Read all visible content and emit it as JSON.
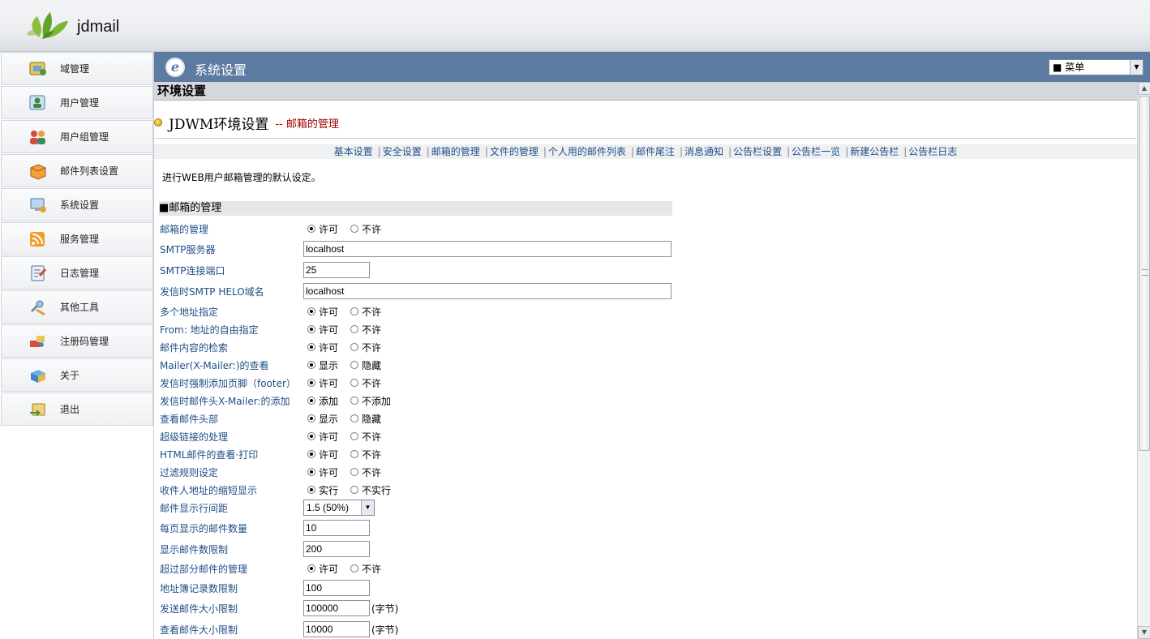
{
  "app": {
    "brand": "jdmail"
  },
  "sidebar": {
    "items": [
      {
        "label": "域管理",
        "icon": "domain-icon"
      },
      {
        "label": "用户管理",
        "icon": "user-icon"
      },
      {
        "label": "用户组管理",
        "icon": "group-icon"
      },
      {
        "label": "邮件列表设置",
        "icon": "mailing-list-icon"
      },
      {
        "label": "系统设置",
        "icon": "settings-icon"
      },
      {
        "label": "服务管理",
        "icon": "rss-icon"
      },
      {
        "label": "日志管理",
        "icon": "log-icon"
      },
      {
        "label": "其他工具",
        "icon": "tools-icon"
      },
      {
        "label": "注册码管理",
        "icon": "key-icon"
      },
      {
        "label": "关于",
        "icon": "about-icon"
      },
      {
        "label": "退出",
        "icon": "exit-icon"
      }
    ]
  },
  "titlebar": {
    "title": "系统设置",
    "menu_value": "■ 菜单"
  },
  "section": {
    "title": "环境设置"
  },
  "heading": {
    "main": "JDWM环境设置",
    "sub": "-- 邮箱的管理"
  },
  "nav": {
    "links": [
      "基本设置",
      "安全设置",
      "邮箱的管理",
      "文件的管理",
      "个人用的邮件列表",
      "邮件尾注",
      "消息通知",
      "公告栏设置",
      "公告栏一览",
      "新建公告栏",
      "公告栏日志"
    ]
  },
  "intro": "进行WEB用户邮箱管理的默认设定。",
  "form": {
    "title": "■邮箱的管理",
    "rows": [
      {
        "label": "邮箱的管理",
        "type": "radio",
        "options": [
          "许可",
          "不许"
        ],
        "selected": 0
      },
      {
        "label": "SMTP服务器",
        "type": "text",
        "value": "localhost",
        "size": "wide"
      },
      {
        "label": "SMTP连接端口",
        "type": "text",
        "value": "25",
        "size": "short"
      },
      {
        "label": "发信时SMTP HELO域名",
        "type": "text",
        "value": "localhost",
        "size": "wide"
      },
      {
        "label": "多个地址指定",
        "type": "radio",
        "options": [
          "许可",
          "不许"
        ],
        "selected": 0
      },
      {
        "label": "From: 地址的自由指定",
        "type": "radio",
        "options": [
          "许可",
          "不许"
        ],
        "selected": 0
      },
      {
        "label": "邮件内容的检索",
        "type": "radio",
        "options": [
          "许可",
          "不许"
        ],
        "selected": 0
      },
      {
        "label": "Mailer(X-Mailer:)的查看",
        "type": "radio",
        "options": [
          "显示",
          "隐藏"
        ],
        "selected": 0
      },
      {
        "label": "发信时强制添加页脚（footer）",
        "type": "radio",
        "options": [
          "许可",
          "不许"
        ],
        "selected": 0
      },
      {
        "label": "发信时邮件头X-Mailer:的添加",
        "type": "radio",
        "options": [
          "添加",
          "不添加"
        ],
        "selected": 0
      },
      {
        "label": "查看邮件头部",
        "type": "radio",
        "options": [
          "显示",
          "隐藏"
        ],
        "selected": 0
      },
      {
        "label": "超级链接的处理",
        "type": "radio",
        "options": [
          "许可",
          "不许"
        ],
        "selected": 0
      },
      {
        "label": "HTML邮件的查看·打印",
        "type": "radio",
        "options": [
          "许可",
          "不许"
        ],
        "selected": 0
      },
      {
        "label": "过滤规则设定",
        "type": "radio",
        "options": [
          "许可",
          "不许"
        ],
        "selected": 0
      },
      {
        "label": "收件人地址的缩短显示",
        "type": "radio",
        "options": [
          "实行",
          "不实行"
        ],
        "selected": 0
      },
      {
        "label": "邮件显示行间距",
        "type": "select",
        "value": "1.5 (50%)"
      },
      {
        "label": "每页显示的邮件数量",
        "type": "text",
        "value": "10",
        "size": "short"
      },
      {
        "label": "显示邮件数限制",
        "type": "text",
        "value": "200",
        "size": "short"
      },
      {
        "label": "超过部分邮件的管理",
        "type": "radio",
        "options": [
          "许可",
          "不许"
        ],
        "selected": 0
      },
      {
        "label": "地址簿记录数限制",
        "type": "text",
        "value": "100",
        "size": "short"
      },
      {
        "label": "发送邮件大小限制",
        "type": "text",
        "value": "100000",
        "size": "short",
        "unit": "(字节)"
      },
      {
        "label": "查看邮件大小限制",
        "type": "text",
        "value": "10000",
        "size": "short",
        "unit": "(字节)"
      }
    ]
  },
  "colors": {
    "titlebar": "#5d7aa1",
    "link": "#1f4e88",
    "accent_red": "#a00000"
  }
}
